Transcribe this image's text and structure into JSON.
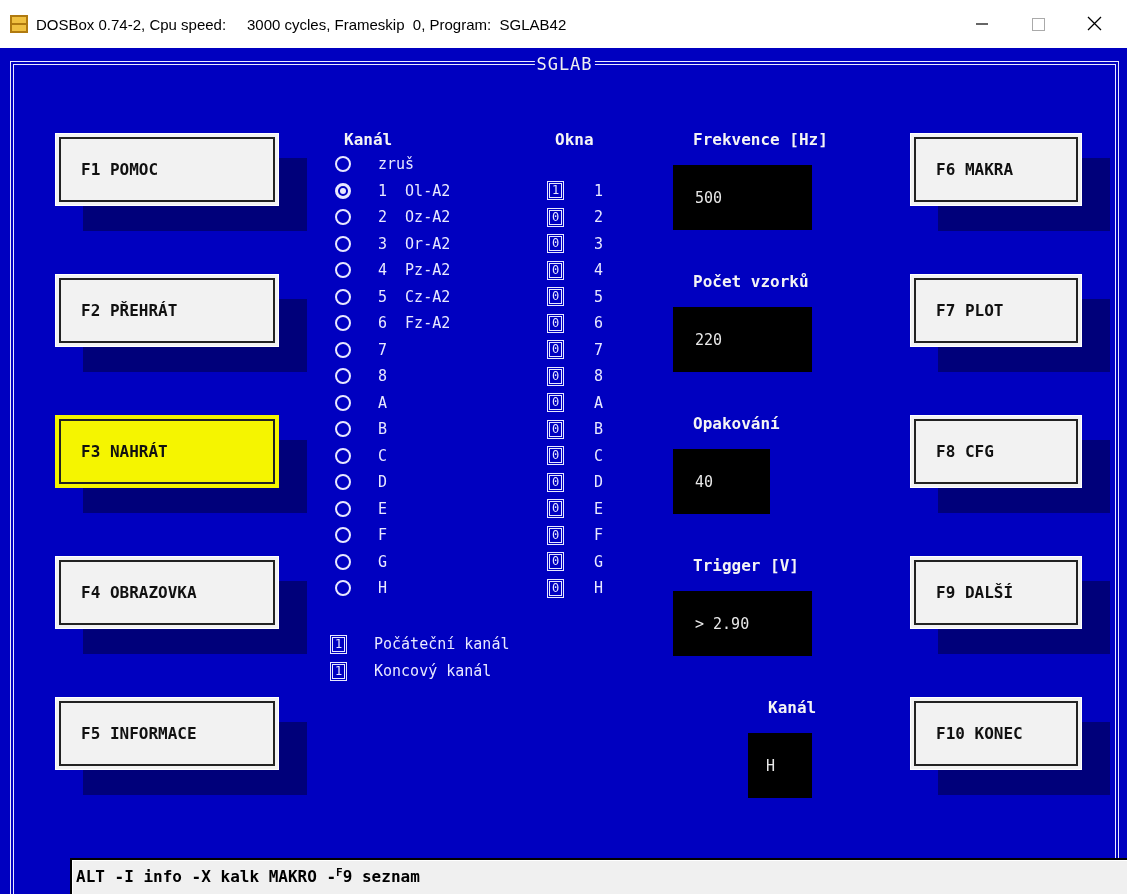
{
  "window": {
    "title": "DOSBox 0.74-2, Cpu speed:     3000 cycles, Frameskip  0, Program:  SGLAB42"
  },
  "screen_title": "SGLAB",
  "left_buttons": [
    {
      "label": "F1 POMOC",
      "selected": false
    },
    {
      "label": "F2 PŘEHRÁT",
      "selected": false
    },
    {
      "label": "F3 NAHRÁT",
      "selected": true
    },
    {
      "label": "F4 OBRAZOVKA",
      "selected": false
    },
    {
      "label": "F5 INFORMACE",
      "selected": false
    }
  ],
  "channel_header": "Kanál",
  "channels": [
    {
      "label": "zruš",
      "selected": false
    },
    {
      "label": "1  Ol-A2",
      "selected": true
    },
    {
      "label": "2  Oz-A2",
      "selected": false
    },
    {
      "label": "3  Or-A2",
      "selected": false
    },
    {
      "label": "4  Pz-A2",
      "selected": false
    },
    {
      "label": "5  Cz-A2",
      "selected": false
    },
    {
      "label": "6  Fz-A2",
      "selected": false
    },
    {
      "label": "7",
      "selected": false
    },
    {
      "label": "8",
      "selected": false
    },
    {
      "label": "A",
      "selected": false
    },
    {
      "label": "B",
      "selected": false
    },
    {
      "label": "C",
      "selected": false
    },
    {
      "label": "D",
      "selected": false
    },
    {
      "label": "E",
      "selected": false
    },
    {
      "label": "F",
      "selected": false
    },
    {
      "label": "G",
      "selected": false
    },
    {
      "label": "H",
      "selected": false
    }
  ],
  "windows_header": "Okna",
  "windows": [
    {
      "value": "1",
      "label": "1"
    },
    {
      "value": "0",
      "label": "2"
    },
    {
      "value": "0",
      "label": "3"
    },
    {
      "value": "0",
      "label": "4"
    },
    {
      "value": "0",
      "label": "5"
    },
    {
      "value": "0",
      "label": "6"
    },
    {
      "value": "0",
      "label": "7"
    },
    {
      "value": "0",
      "label": "8"
    },
    {
      "value": "0",
      "label": "A"
    },
    {
      "value": "0",
      "label": "B"
    },
    {
      "value": "0",
      "label": "C"
    },
    {
      "value": "0",
      "label": "D"
    },
    {
      "value": "0",
      "label": "E"
    },
    {
      "value": "0",
      "label": "F"
    },
    {
      "value": "0",
      "label": "G"
    },
    {
      "value": "0",
      "label": "H"
    }
  ],
  "range": [
    {
      "value": "1",
      "label": "Počáteční kanál"
    },
    {
      "value": "1",
      "label": "Koncový kanál"
    }
  ],
  "fields": [
    {
      "label": "Frekvence [Hz]",
      "value": "500",
      "kind": "wide"
    },
    {
      "label": "Počet vzorků",
      "value": "220",
      "kind": "wide"
    },
    {
      "label": "Opakování",
      "value": "40",
      "kind": "narrow"
    },
    {
      "label": "Trigger [V]",
      "value": "> 2.90",
      "kind": "wide"
    },
    {
      "label": "Kanál",
      "value": "H",
      "kind": "small"
    }
  ],
  "right_buttons": [
    {
      "label": "F6 MAKRA",
      "selected": false
    },
    {
      "label": "F7 PLOT",
      "selected": false
    },
    {
      "label": "F8 CFG",
      "selected": false
    },
    {
      "label": "F9 DALŠÍ",
      "selected": false
    },
    {
      "label": "F10 KONEC",
      "selected": false
    }
  ],
  "status_bar": "ALT -I info -X kalk MAKRO -$^{F}$9 seznam"
}
